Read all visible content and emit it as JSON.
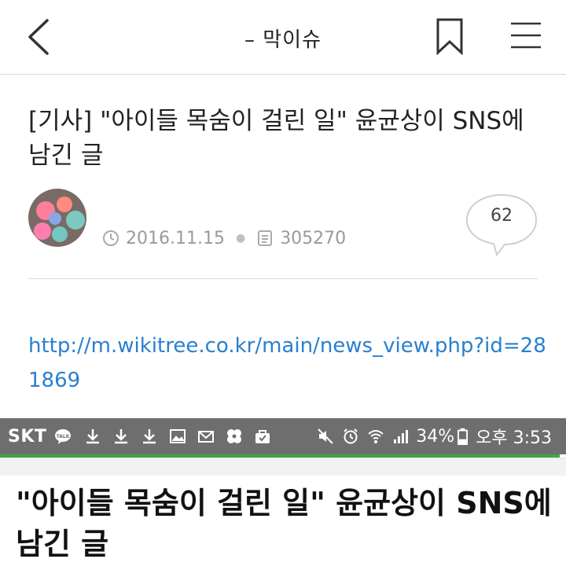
{
  "nav": {
    "title": "–  막이슈",
    "back_icon": "chevron-left-icon",
    "bookmark_icon": "bookmark-icon",
    "menu_icon": "hamburger-menu-icon"
  },
  "article": {
    "title": "[기사] \"아이들 목숨이 걸린 일\" 윤균상이 SNS에 남긴 글",
    "date": "2016.11.15",
    "views": "305270",
    "comment_count": "62",
    "link": "http://m.wikitree.co.kr/main/news_view.php?id=281869"
  },
  "status_bar": {
    "carrier": "SKT",
    "battery": "34%",
    "time": "오후 3:53"
  },
  "overlay_article": {
    "title": "\"아이들 목숨이 걸린 일\" 윤균상이 SNS에 남긴 글"
  },
  "colors": {
    "link": "#2a7fd0",
    "status_bar_bg": "#6e6e6e",
    "progress": "#3da540"
  }
}
